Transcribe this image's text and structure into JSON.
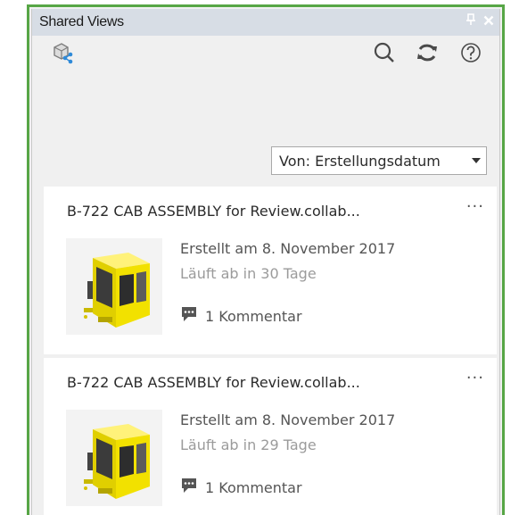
{
  "window": {
    "title": "Shared Views",
    "pin_glyph": "↑",
    "close_glyph": "✕"
  },
  "toolbar": {
    "left_icon": "shared-views-icon",
    "right_icons": [
      "search-icon",
      "refresh-icon",
      "help-icon"
    ]
  },
  "sort": {
    "label": "Von: Erstellungsdatum"
  },
  "cards": [
    {
      "title": "B-722 CAB ASSEMBLY for Review.collab...",
      "more": "···",
      "created": "Erstellt am 8. November 2017",
      "expires": "Läuft ab in 30 Tage",
      "comments": "1 Kommentar"
    },
    {
      "title": "B-722 CAB ASSEMBLY for Review.collab...",
      "more": "···",
      "created": "Erstellt am 8. November 2017",
      "expires": "Läuft ab in 29 Tage",
      "comments": "1 Kommentar"
    }
  ],
  "colors": {
    "frame": "#57a646",
    "titlebar": "#d7dde5",
    "accent_blue": "#2f8ad8",
    "cab_yellow": "#f2e100"
  }
}
